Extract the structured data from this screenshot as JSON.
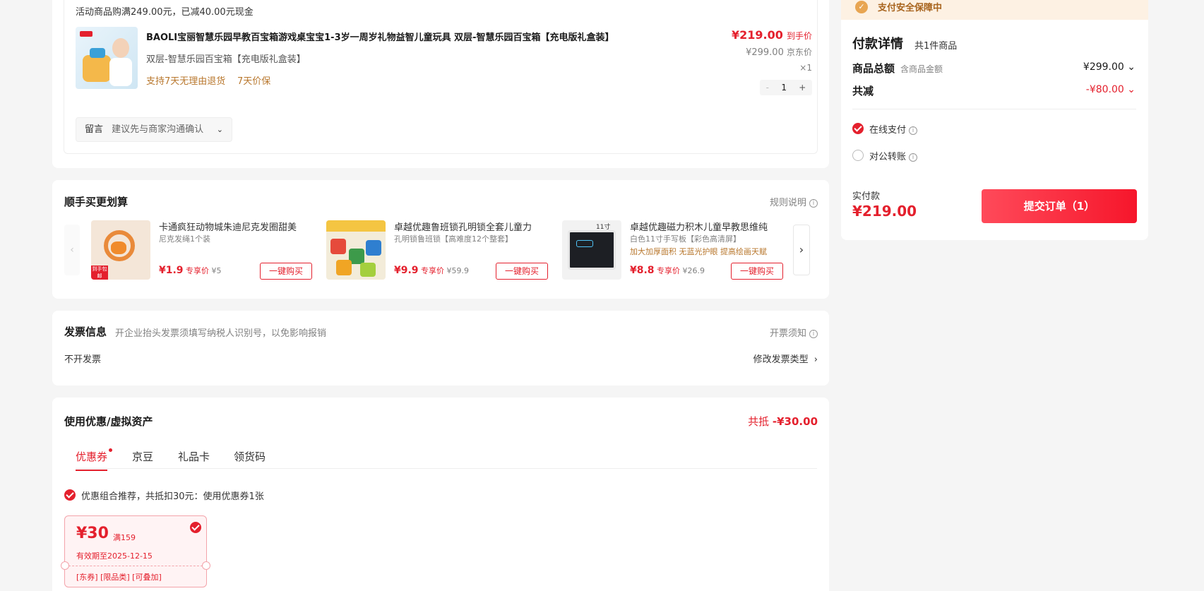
{
  "order": {
    "promo_note": "活动商品购满249.00元，已减40.00元现金",
    "product": {
      "title": "BAOLI宝丽智慧乐园早教百宝箱游戏桌宝宝1-3岁一周岁礼物益智儿童玩具 双层-智慧乐园百宝箱【充电版礼盒装】",
      "variant": "双层-智慧乐园百宝箱【充电版礼盒装】",
      "service_return": "支持7天无理由退货",
      "service_price": "7天价保",
      "price": "¥219.00",
      "price_tag": "到手价",
      "jd_price": "¥299.00",
      "jd_price_tag": "京东价",
      "qty_label": "×1",
      "qty_minus": "-",
      "qty_value": "1",
      "qty_plus": "+"
    },
    "message_label": "留言",
    "message_placeholder": "建议先与商家沟通确认"
  },
  "addon": {
    "title": "顺手买更划算",
    "rules": "规则说明",
    "items": [
      {
        "name": "卡通疯狂动物城朱迪尼克发圈甜美",
        "sub": "尼克发绳1个装",
        "promo": "",
        "price": "¥1.9",
        "tag": "专享价",
        "orig": "¥5",
        "btn": "一键购买"
      },
      {
        "name": "卓越优趣鲁班锁孔明锁全套儿童力",
        "sub": "孔明锁鲁班锁【高难度12个整套】",
        "promo": "",
        "price": "¥9.9",
        "tag": "专享价",
        "orig": "¥59.9",
        "btn": "一键购买"
      },
      {
        "name": "卓越优趣磁力积木儿童早教思维纯",
        "sub": "白色11寸手写板【彩色高清屏】",
        "promo": "加大加厚面积 无蓝光护眼 提高绘画天赋",
        "price": "¥8.8",
        "tag": "专享价",
        "orig": "¥26.9",
        "btn": "一键购买"
      }
    ],
    "thumb3_text": "11寸",
    "thumb1_badge": "到手包邮"
  },
  "invoice": {
    "title": "发票信息",
    "note": "开企业抬头发票须填写纳税人识别号，以免影响报销",
    "notice": "开票须知",
    "value": "不开发票",
    "change": "修改发票类型"
  },
  "coupon": {
    "title": "使用优惠/虚拟资产",
    "total_label": "共抵",
    "total_value": "-¥30.00",
    "tabs": [
      "优惠券",
      "京豆",
      "礼品卡",
      "领货码"
    ],
    "recommend": "优惠组合推荐，共抵扣30元：使用优惠券1张",
    "card": {
      "amount": "¥30",
      "cond": "满159",
      "expiry": "有效期至2025-12-15",
      "tags": "[东券] [限品类] [可叠加]"
    }
  },
  "payment": {
    "safety": "支付安全保障中",
    "title": "付款详情",
    "count": "共1件商品",
    "goods_label": "商品总额",
    "goods_sub": "含商品金额",
    "goods_value": "¥299.00",
    "reduce_label": "共减",
    "reduce_value": "-¥80.00",
    "method_online": "在线支付",
    "method_transfer": "对公转账",
    "actual_label": "实付款",
    "actual_value": "¥219.00",
    "submit": "提交订单（1）"
  },
  "colors": {
    "accent": "#e4202d",
    "orange": "#b8772d",
    "bg": "#f5f5f5"
  }
}
